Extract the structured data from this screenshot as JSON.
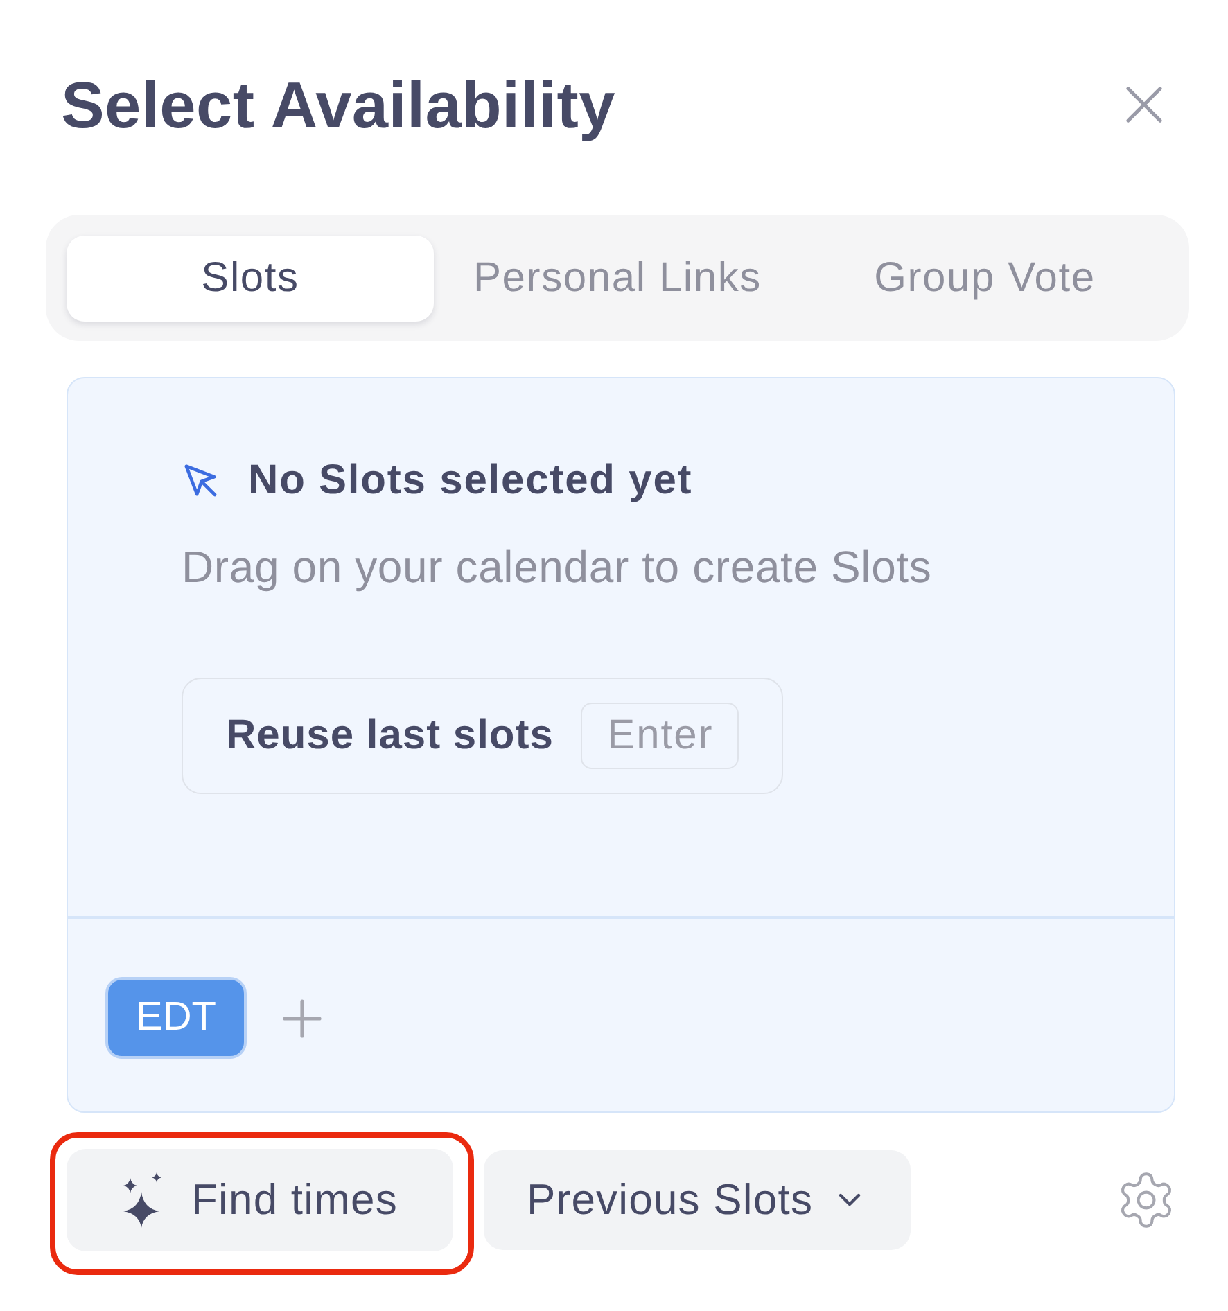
{
  "dialog": {
    "title": "Select Availability"
  },
  "tabs": [
    {
      "label": "Slots",
      "selected": true
    },
    {
      "label": "Personal Links",
      "selected": false
    },
    {
      "label": "Group Vote",
      "selected": false
    }
  ],
  "empty_state": {
    "heading": "No Slots selected yet",
    "description": "Drag on your calendar to create Slots",
    "reuse_button": {
      "label": "Reuse last slots",
      "shortcut": "Enter"
    }
  },
  "timezones": [
    {
      "label": "EDT",
      "selected": true
    }
  ],
  "actions": {
    "find_times": {
      "label": "Find times",
      "highlighted": true
    },
    "previous_slots": {
      "label": "Previous Slots"
    }
  }
}
